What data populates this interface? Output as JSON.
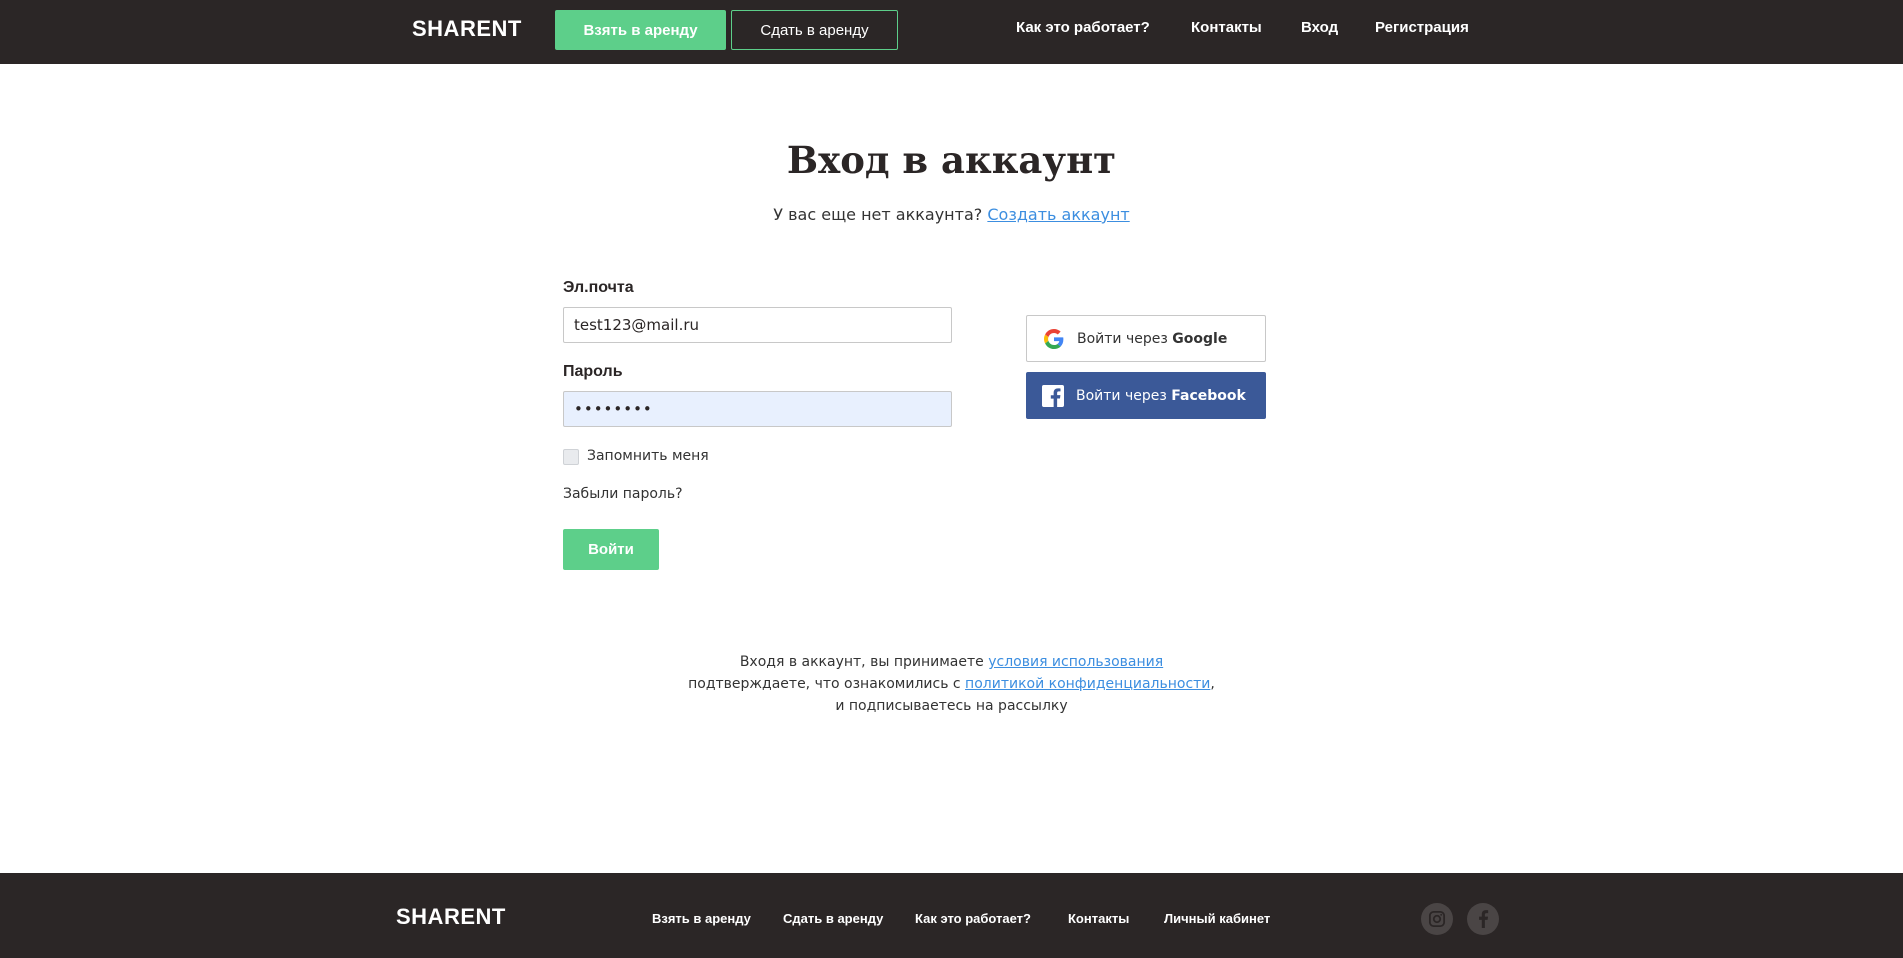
{
  "header": {
    "logo": "SHARENT",
    "rent_button": "Взять в аренду",
    "lend_button": "Сдать в аренду",
    "nav": {
      "how_it_works": "Как это работает?",
      "contacts": "Контакты",
      "login": "Вход",
      "register": "Регистрация"
    }
  },
  "login": {
    "title": "Вход в аккаунт",
    "no_account_text": "У вас еще нет аккаунта?",
    "create_account_link": "Создать аккаунт",
    "email_label": "Эл.почта",
    "email_value": "test123@mail.ru",
    "password_label": "Пароль",
    "password_value": "12345678",
    "remember_me": "Запомнить меня",
    "remember_checked": false,
    "forgot_password": "Забыли пароль?",
    "submit": "Войти"
  },
  "social": {
    "google_prefix": "Войти через",
    "google_brand": "Google",
    "facebook_prefix": "Войти через",
    "facebook_brand": "Facebook"
  },
  "terms": {
    "line1_text": "Входя в аккаунт, вы принимаете",
    "line1_link": "условия использования",
    "line2_text": "подтверждаете, что ознакомились с",
    "line2_link": "политикой конфиденциальности",
    "line2_end": ",",
    "line3_text": "и подписываетесь на рассылку"
  },
  "footer": {
    "logo": "SHARENT",
    "nav": {
      "rent": "Взять в аренду",
      "lend": "Сдать в аренду",
      "how_it_works": "Как это работает?",
      "contacts": "Контакты",
      "cabinet": "Личный кабинет"
    },
    "social_icons": [
      "instagram-icon",
      "facebook-icon"
    ]
  },
  "colors": {
    "dark": "#2b2626",
    "accent_green": "#5dcf8a",
    "link_blue": "#3c8ee0",
    "facebook_blue": "#3b5998",
    "autofill_bg": "#e8f0fe"
  }
}
